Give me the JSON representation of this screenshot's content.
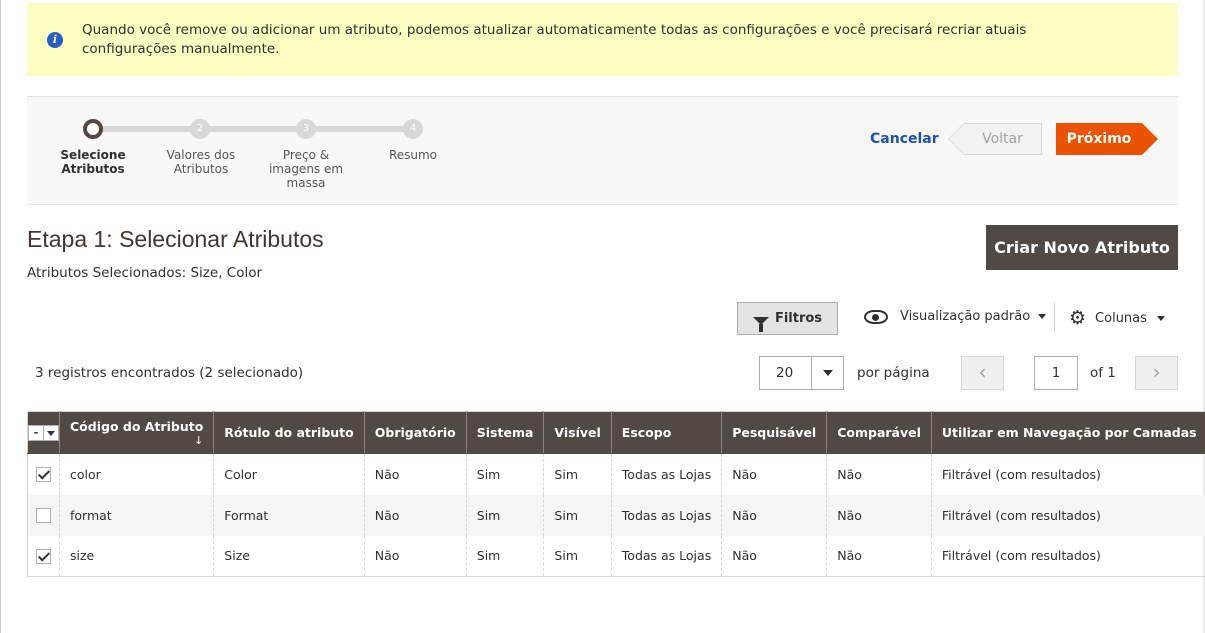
{
  "notice": {
    "text": "Quando você remove ou adicionar um atributo, podemos atualizar automaticamente todas as configurações e você precisará recriar atuais configurações manualmente."
  },
  "wizard": {
    "steps": [
      {
        "number": "",
        "label": "Selecione Atributos",
        "active": true
      },
      {
        "number": "2",
        "label": "Valores dos Atributos",
        "active": false
      },
      {
        "number": "3",
        "label": "Preço & imagens em massa",
        "active": false
      },
      {
        "number": "4",
        "label": "Resumo",
        "active": false
      }
    ],
    "cancel_label": "Cancelar",
    "back_label": "Voltar",
    "next_label": "Próximo"
  },
  "page": {
    "title": "Etapa 1: Selecionar Atributos",
    "selected_text": "Atributos Selecionados: Size, Color",
    "create_button": "Criar Novo Atributo"
  },
  "toolbar": {
    "filters_label": "Filtros",
    "view_label": "Visualização padrão",
    "columns_label": "Colunas"
  },
  "pager": {
    "records_text": "3 registros encontrados (2 selecionado)",
    "per_page_value": "20",
    "per_page_label": "por página",
    "prev_icon": "‹",
    "next_icon": "›",
    "current_page": "1",
    "of_label": "of 1"
  },
  "table": {
    "mass_select_label": "-",
    "sort_indicator": "↓",
    "headers": [
      "Código do Atributo",
      "Rótulo do atributo",
      "Obrigatório",
      "Sistema",
      "Visível",
      "Escopo",
      "Pesquisável",
      "Comparável",
      "Utilizar em Navegação por Camadas"
    ],
    "rows": [
      {
        "checked": true,
        "cells": [
          "color",
          "Color",
          "Não",
          "Sim",
          "Sim",
          "Todas as Lojas",
          "Não",
          "Não",
          "Filtrável (com resultados)"
        ]
      },
      {
        "checked": false,
        "cells": [
          "format",
          "Format",
          "Não",
          "Sim",
          "Sim",
          "Todas as Lojas",
          "Não",
          "Não",
          "Filtrável (com resultados)"
        ]
      },
      {
        "checked": true,
        "cells": [
          "size",
          "Size",
          "Não",
          "Sim",
          "Sim",
          "Todas as Lojas",
          "Não",
          "Não",
          "Filtrável (com resultados)"
        ]
      }
    ]
  },
  "colors": {
    "accent": "#eb5202",
    "dark": "#514943",
    "notice_bg": "#fbfdc1",
    "link": "#1f4fb5"
  }
}
